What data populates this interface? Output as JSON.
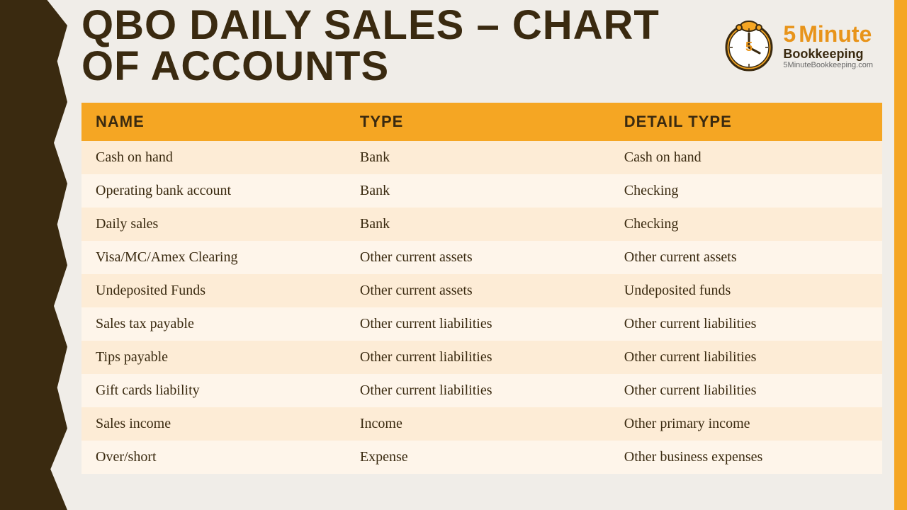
{
  "page": {
    "title": "QBO DAILY SALES – CHART OF ACCOUNTS",
    "background_color": "#f0ede8"
  },
  "logo": {
    "five": "5",
    "minute": "Minute",
    "bookkeeping": "Bookkeeping",
    "url": "5MinuteBookkeeping.com"
  },
  "table": {
    "headers": [
      "NAME",
      "TYPE",
      "DETAIL TYPE"
    ],
    "rows": [
      [
        "Cash on hand",
        "Bank",
        "Cash on hand"
      ],
      [
        "Operating bank account",
        "Bank",
        "Checking"
      ],
      [
        "Daily sales",
        "Bank",
        "Checking"
      ],
      [
        "Visa/MC/Amex Clearing",
        "Other current assets",
        "Other current assets"
      ],
      [
        "Undeposited Funds",
        "Other current assets",
        "Undeposited funds"
      ],
      [
        "Sales tax payable",
        "Other current liabilities",
        "Other current liabilities"
      ],
      [
        "Tips payable",
        "Other current liabilities",
        "Other current liabilities"
      ],
      [
        "Gift cards liability",
        "Other current liabilities",
        "Other current liabilities"
      ],
      [
        "Sales income",
        "Income",
        "Other primary income"
      ],
      [
        "Over/short",
        "Expense",
        "Other business expenses"
      ]
    ]
  }
}
